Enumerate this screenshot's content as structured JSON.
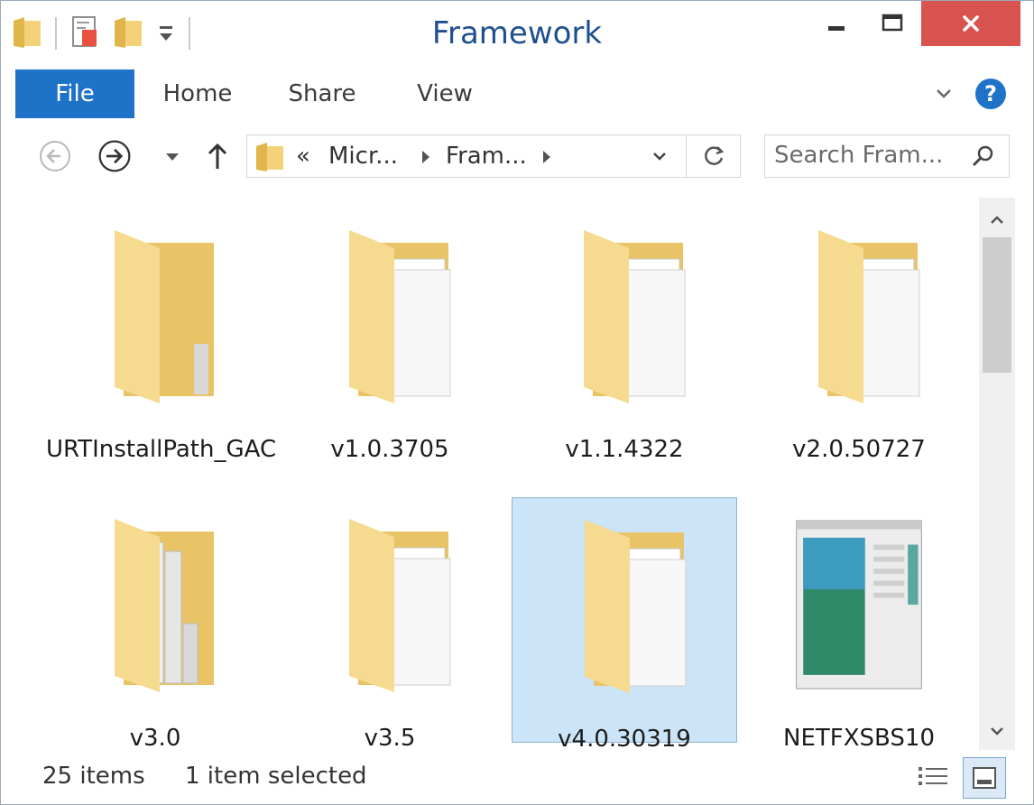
{
  "window": {
    "title": "Framework"
  },
  "ribbon": {
    "tabs": [
      {
        "label": "File"
      },
      {
        "label": "Home"
      },
      {
        "label": "Share"
      },
      {
        "label": "View"
      }
    ],
    "help_label": "?"
  },
  "address": {
    "overflow": "«",
    "crumbs": [
      "Micr...",
      "Fram..."
    ]
  },
  "search": {
    "placeholder": "Search Fram..."
  },
  "items": [
    {
      "name": "URTInstallPath_GAC",
      "type": "folder-empty"
    },
    {
      "name": "v1.0.3705",
      "type": "folder-docs"
    },
    {
      "name": "v1.1.4322",
      "type": "folder-docs"
    },
    {
      "name": "v2.0.50727",
      "type": "folder-docs"
    },
    {
      "name": "v3.0",
      "type": "folder-files"
    },
    {
      "name": "v3.5",
      "type": "folder-docs"
    },
    {
      "name": "v4.0.30319",
      "type": "folder-docs",
      "selected": true
    },
    {
      "name": "NETFXSBS10",
      "type": "app-window"
    }
  ],
  "status": {
    "count": "25 items",
    "selection": "1 item selected"
  },
  "colors": {
    "accent": "#1e72c8",
    "close": "#d9534f",
    "selection": "#cce4f7",
    "title": "#1f4f8f"
  }
}
